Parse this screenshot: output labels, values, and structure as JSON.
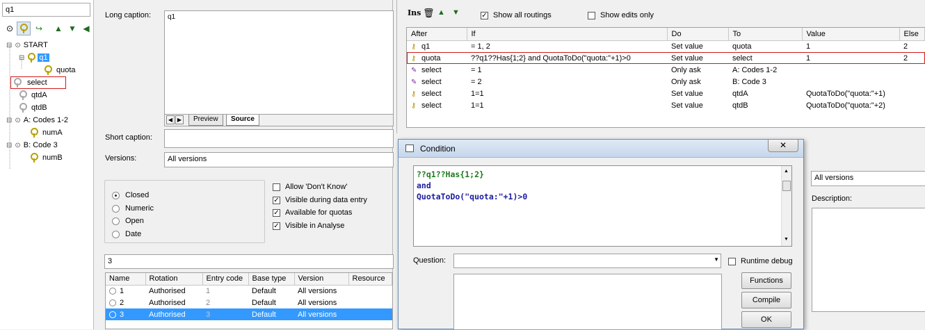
{
  "tree": {
    "search_value": "q1",
    "toolbar_icons": [
      "circle-icon",
      "key-icon",
      "refresh-icon",
      "arrow-up-icon",
      "arrow-down-icon",
      "arrow-left-icon"
    ],
    "nodes": [
      {
        "label": "START",
        "indent": 0,
        "kind": "circle"
      },
      {
        "label": "q1",
        "indent": 1,
        "kind": "key",
        "selected": true
      },
      {
        "label": "quota",
        "indent": 2,
        "kind": "key"
      },
      {
        "label": "select",
        "indent": 0,
        "kind": "key",
        "highlighted": true
      },
      {
        "label": "qtdA",
        "indent": 0,
        "kind": "key-grey"
      },
      {
        "label": "qtdB",
        "indent": 0,
        "kind": "key-grey"
      },
      {
        "label": "A: Codes 1-2",
        "indent": 0,
        "kind": "circle"
      },
      {
        "label": "numA",
        "indent": 1,
        "kind": "key9"
      },
      {
        "label": "B: Code 3",
        "indent": 0,
        "kind": "circle"
      },
      {
        "label": "numB",
        "indent": 1,
        "kind": "key9"
      }
    ]
  },
  "question": {
    "long_caption_label": "Long caption:",
    "long_caption_value": "q1",
    "tab_preview": "Preview",
    "tab_source": "Source",
    "short_caption_label": "Short caption:",
    "versions_label": "Versions:",
    "versions_value": "All versions",
    "types": [
      {
        "label": "Closed",
        "checked": true
      },
      {
        "label": "Numeric",
        "checked": false
      },
      {
        "label": "Open",
        "checked": false
      },
      {
        "label": "Date",
        "checked": false
      }
    ],
    "options": [
      {
        "label": "Allow 'Don't Know'",
        "checked": false
      },
      {
        "label": "Visible during data entry",
        "checked": true
      },
      {
        "label": "Available for quotas",
        "checked": true
      },
      {
        "label": "Visible in Analyse",
        "checked": true
      }
    ],
    "code_field_value": "3",
    "version_table": {
      "columns": [
        "Name",
        "Rotation",
        "Entry code",
        "Base type",
        "Version",
        "Resource"
      ],
      "rows": [
        [
          "1",
          "Authorised",
          "1",
          "Default",
          "All versions",
          ""
        ],
        [
          "2",
          "Authorised",
          "2",
          "Default",
          "All versions",
          ""
        ],
        [
          "3",
          "Authorised",
          "3",
          "Default",
          "All versions",
          ""
        ]
      ]
    }
  },
  "routing": {
    "ins_label": "Ins",
    "show_all_label": "Show all routings",
    "show_all_checked": true,
    "show_edits_label": "Show edits only",
    "show_edits_checked": false,
    "columns": [
      "After",
      "If",
      "Do",
      "To",
      "Value",
      "Else"
    ],
    "rows": [
      [
        "q1",
        "= 1, 2",
        "Set value",
        "quota",
        "1",
        "2"
      ],
      [
        "quota",
        "??q1??Has{1;2} and  QuotaToDo(\"quota:\"+1)>0",
        "Set value",
        "select",
        "1",
        "2"
      ],
      [
        "select",
        "= 1",
        "Only ask",
        "A: Codes 1-2",
        "",
        ""
      ],
      [
        "select",
        "= 2",
        "Only ask",
        "B: Code 3",
        "",
        ""
      ],
      [
        "select",
        "1=1",
        "Set value",
        "qtdA",
        "QuotaToDo(\"quota:\"+1)",
        ""
      ],
      [
        "select",
        "1=1",
        "Set value",
        "qtdB",
        "QuotaToDo(\"quota:\"+2)",
        ""
      ]
    ]
  },
  "condition_dialog": {
    "title": "Condition",
    "code_line1": "??q1??Has{1;2}",
    "code_line2": "and",
    "code_line3": "QuotaToDo(\"quota:\"+1)>0",
    "question_label": "Question:",
    "runtime_debug_label": "Runtime debug",
    "btn_functions": "Functions",
    "btn_compile": "Compile",
    "btn_ok": "OK"
  },
  "props": {
    "versions_value": "All versions",
    "description_label": "Description:"
  }
}
